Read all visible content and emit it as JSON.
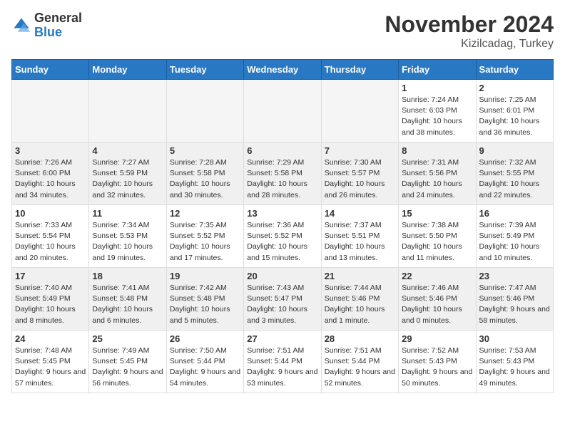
{
  "header": {
    "logo_general": "General",
    "logo_blue": "Blue",
    "month_title": "November 2024",
    "location": "Kizilcadag, Turkey"
  },
  "weekdays": [
    "Sunday",
    "Monday",
    "Tuesday",
    "Wednesday",
    "Thursday",
    "Friday",
    "Saturday"
  ],
  "weeks": [
    [
      {
        "day": "",
        "empty": true
      },
      {
        "day": "",
        "empty": true
      },
      {
        "day": "",
        "empty": true
      },
      {
        "day": "",
        "empty": true
      },
      {
        "day": "",
        "empty": true
      },
      {
        "day": "1",
        "sunrise": "7:24 AM",
        "sunset": "6:03 PM",
        "daylight": "10 hours and 38 minutes."
      },
      {
        "day": "2",
        "sunrise": "7:25 AM",
        "sunset": "6:01 PM",
        "daylight": "10 hours and 36 minutes."
      }
    ],
    [
      {
        "day": "3",
        "sunrise": "7:26 AM",
        "sunset": "6:00 PM",
        "daylight": "10 hours and 34 minutes."
      },
      {
        "day": "4",
        "sunrise": "7:27 AM",
        "sunset": "5:59 PM",
        "daylight": "10 hours and 32 minutes."
      },
      {
        "day": "5",
        "sunrise": "7:28 AM",
        "sunset": "5:58 PM",
        "daylight": "10 hours and 30 minutes."
      },
      {
        "day": "6",
        "sunrise": "7:29 AM",
        "sunset": "5:58 PM",
        "daylight": "10 hours and 28 minutes."
      },
      {
        "day": "7",
        "sunrise": "7:30 AM",
        "sunset": "5:57 PM",
        "daylight": "10 hours and 26 minutes."
      },
      {
        "day": "8",
        "sunrise": "7:31 AM",
        "sunset": "5:56 PM",
        "daylight": "10 hours and 24 minutes."
      },
      {
        "day": "9",
        "sunrise": "7:32 AM",
        "sunset": "5:55 PM",
        "daylight": "10 hours and 22 minutes."
      }
    ],
    [
      {
        "day": "10",
        "sunrise": "7:33 AM",
        "sunset": "5:54 PM",
        "daylight": "10 hours and 20 minutes."
      },
      {
        "day": "11",
        "sunrise": "7:34 AM",
        "sunset": "5:53 PM",
        "daylight": "10 hours and 19 minutes."
      },
      {
        "day": "12",
        "sunrise": "7:35 AM",
        "sunset": "5:52 PM",
        "daylight": "10 hours and 17 minutes."
      },
      {
        "day": "13",
        "sunrise": "7:36 AM",
        "sunset": "5:52 PM",
        "daylight": "10 hours and 15 minutes."
      },
      {
        "day": "14",
        "sunrise": "7:37 AM",
        "sunset": "5:51 PM",
        "daylight": "10 hours and 13 minutes."
      },
      {
        "day": "15",
        "sunrise": "7:38 AM",
        "sunset": "5:50 PM",
        "daylight": "10 hours and 11 minutes."
      },
      {
        "day": "16",
        "sunrise": "7:39 AM",
        "sunset": "5:49 PM",
        "daylight": "10 hours and 10 minutes."
      }
    ],
    [
      {
        "day": "17",
        "sunrise": "7:40 AM",
        "sunset": "5:49 PM",
        "daylight": "10 hours and 8 minutes."
      },
      {
        "day": "18",
        "sunrise": "7:41 AM",
        "sunset": "5:48 PM",
        "daylight": "10 hours and 6 minutes."
      },
      {
        "day": "19",
        "sunrise": "7:42 AM",
        "sunset": "5:48 PM",
        "daylight": "10 hours and 5 minutes."
      },
      {
        "day": "20",
        "sunrise": "7:43 AM",
        "sunset": "5:47 PM",
        "daylight": "10 hours and 3 minutes."
      },
      {
        "day": "21",
        "sunrise": "7:44 AM",
        "sunset": "5:46 PM",
        "daylight": "10 hours and 1 minute."
      },
      {
        "day": "22",
        "sunrise": "7:46 AM",
        "sunset": "5:46 PM",
        "daylight": "10 hours and 0 minutes."
      },
      {
        "day": "23",
        "sunrise": "7:47 AM",
        "sunset": "5:46 PM",
        "daylight": "9 hours and 58 minutes."
      }
    ],
    [
      {
        "day": "24",
        "sunrise": "7:48 AM",
        "sunset": "5:45 PM",
        "daylight": "9 hours and 57 minutes."
      },
      {
        "day": "25",
        "sunrise": "7:49 AM",
        "sunset": "5:45 PM",
        "daylight": "9 hours and 56 minutes."
      },
      {
        "day": "26",
        "sunrise": "7:50 AM",
        "sunset": "5:44 PM",
        "daylight": "9 hours and 54 minutes."
      },
      {
        "day": "27",
        "sunrise": "7:51 AM",
        "sunset": "5:44 PM",
        "daylight": "9 hours and 53 minutes."
      },
      {
        "day": "28",
        "sunrise": "7:51 AM",
        "sunset": "5:44 PM",
        "daylight": "9 hours and 52 minutes."
      },
      {
        "day": "29",
        "sunrise": "7:52 AM",
        "sunset": "5:43 PM",
        "daylight": "9 hours and 50 minutes."
      },
      {
        "day": "30",
        "sunrise": "7:53 AM",
        "sunset": "5:43 PM",
        "daylight": "9 hours and 49 minutes."
      }
    ]
  ]
}
